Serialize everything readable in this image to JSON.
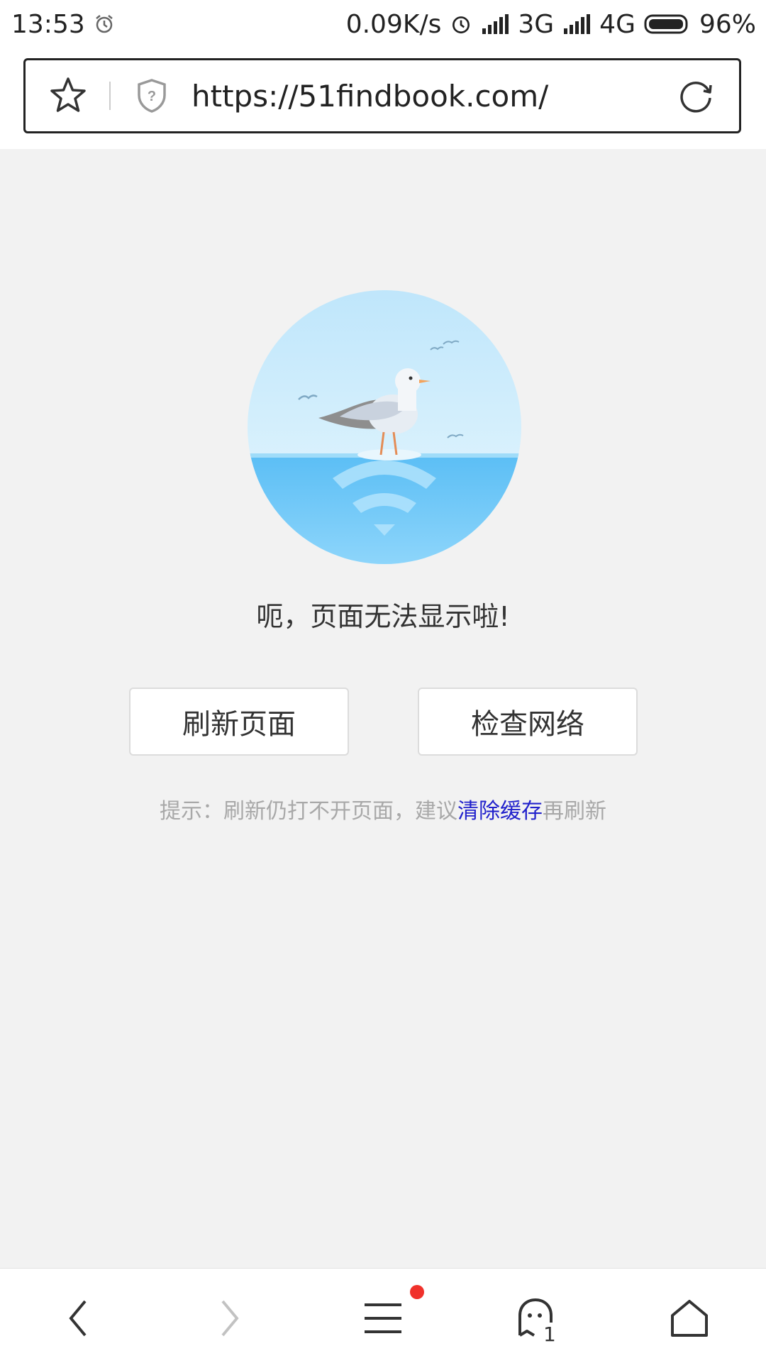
{
  "status_bar": {
    "time": "13:53",
    "speed": "0.09K/s",
    "network_1": "3G",
    "network_2": "4G",
    "battery": "96%"
  },
  "browser": {
    "url": "https://51findbook.com/"
  },
  "error_page": {
    "message": "呃，页面无法显示啦!",
    "refresh_button": "刷新页面",
    "check_network_button": "检查网络",
    "hint_prefix": "提示：刷新仍打不开页面，建议",
    "hint_link": "清除缓存",
    "hint_suffix": "再刷新"
  },
  "bottom_bar": {
    "tab_count": "1",
    "menu_badge_color": "#f0312b"
  },
  "icons": [
    "alarm-icon",
    "signal-icon",
    "battery-icon",
    "star-icon",
    "shield-icon",
    "reload-icon",
    "back-icon",
    "forward-icon",
    "menu-icon",
    "tabs-icon",
    "home-icon"
  ],
  "colors": {
    "background": "#f2f2f2",
    "link": "#2222cc",
    "hint": "#a8a8a8"
  }
}
